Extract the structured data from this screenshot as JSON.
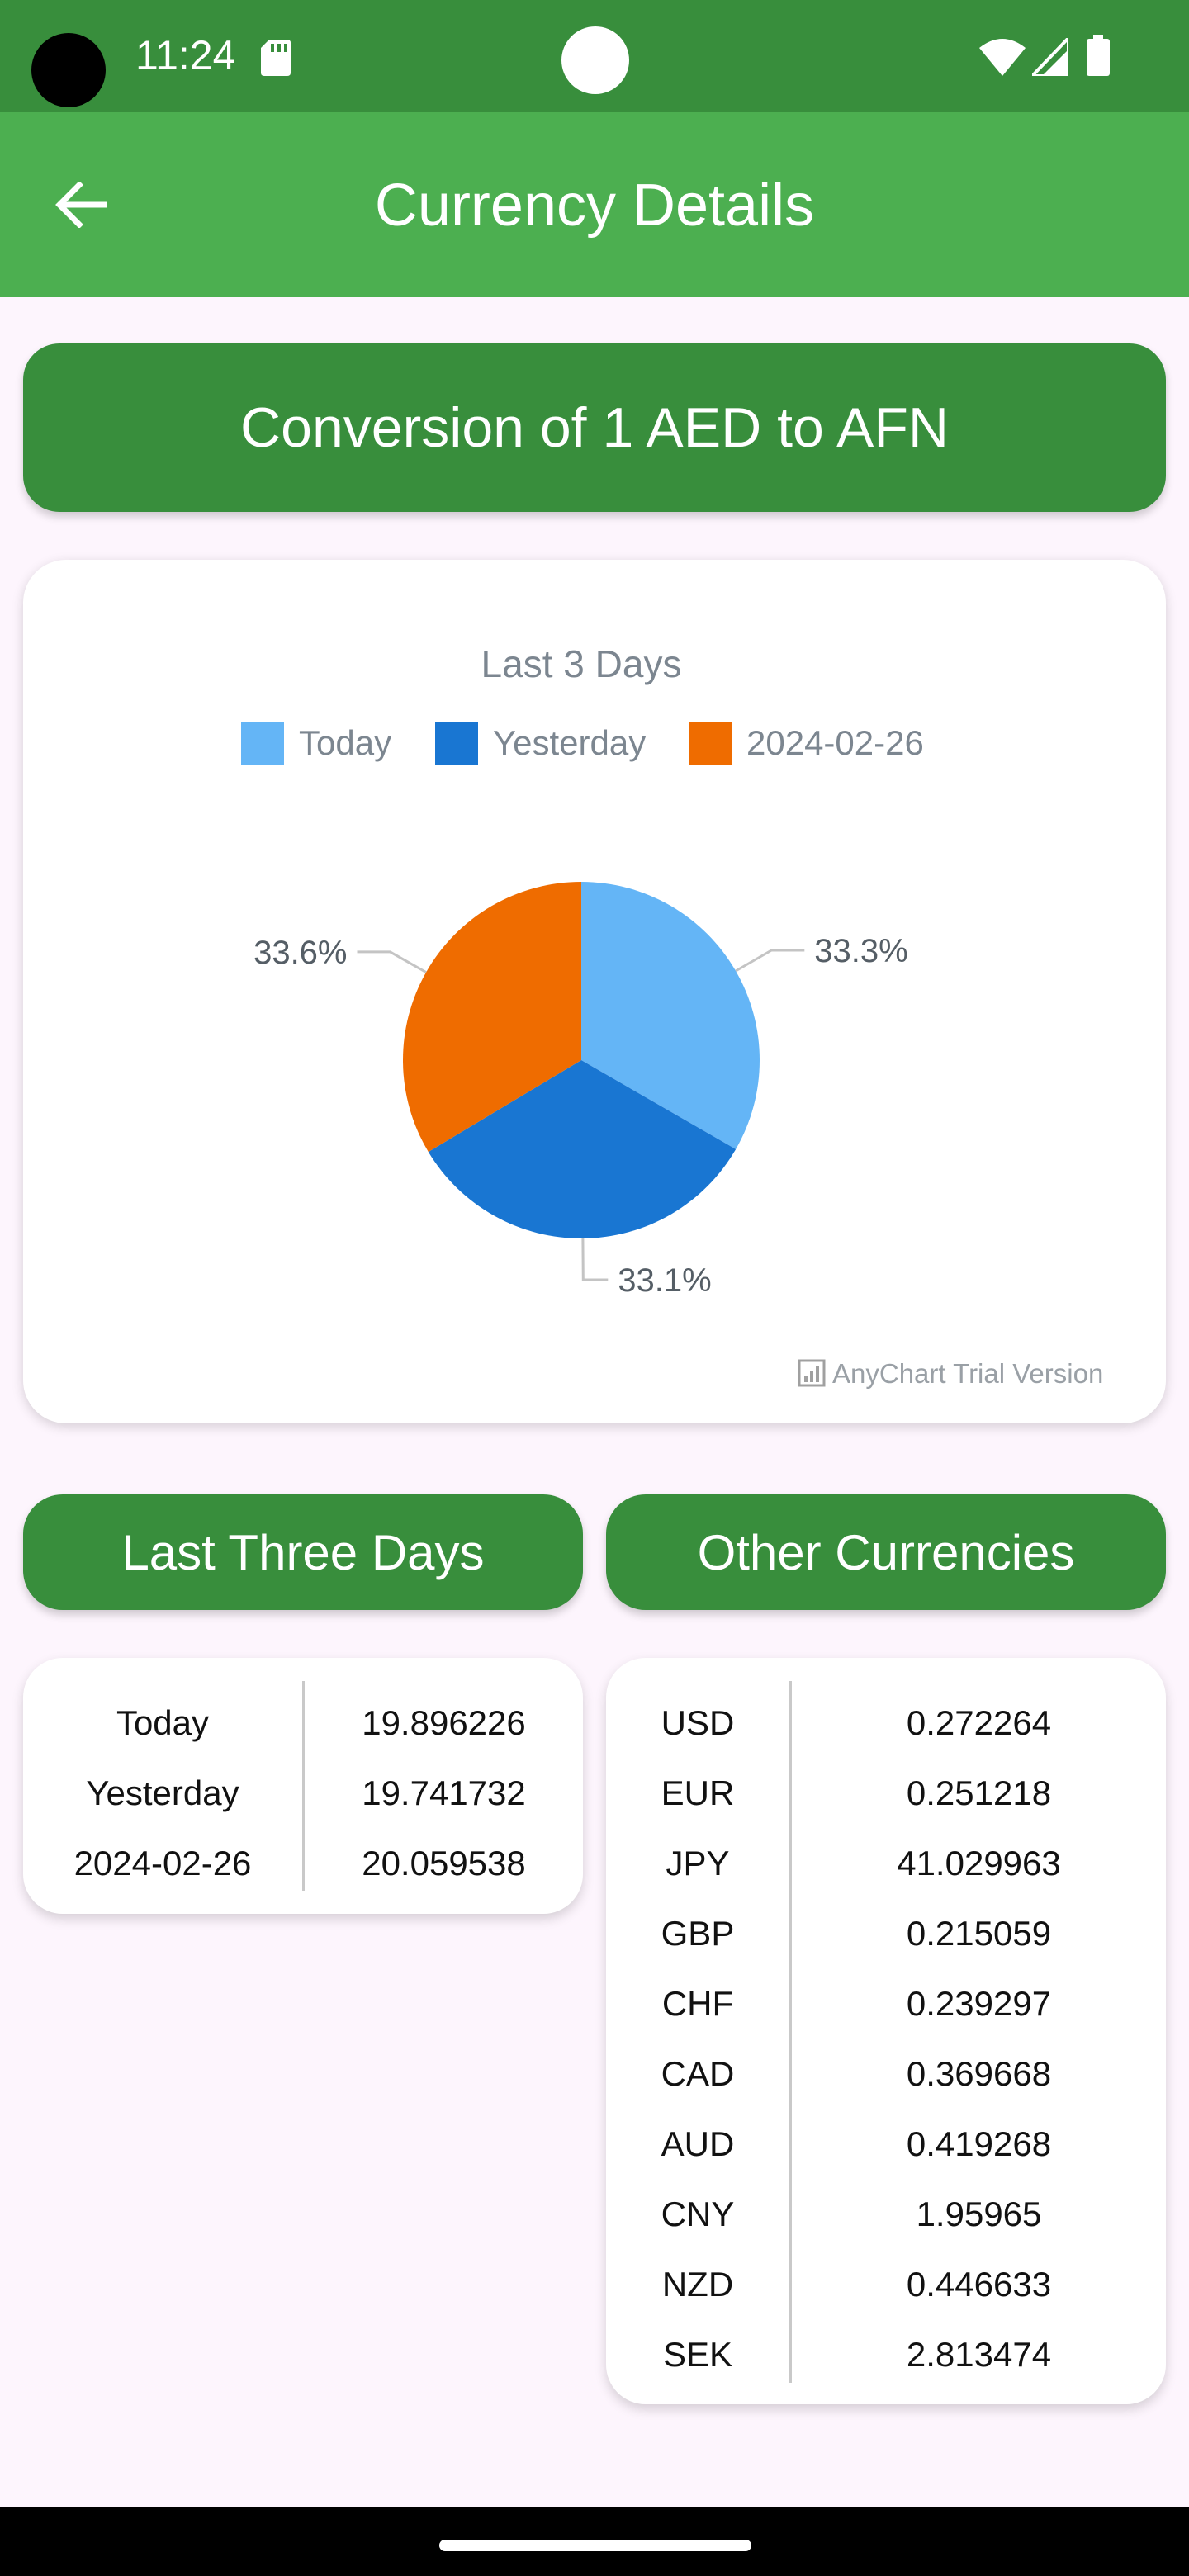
{
  "status_bar": {
    "time": "11:24",
    "icons": [
      "sd-card-icon",
      "wifi-icon",
      "signal-icon",
      "battery-icon"
    ]
  },
  "app_bar": {
    "title": "Currency Details",
    "back_icon": "arrow-left-icon"
  },
  "conversion": {
    "label": "Conversion of 1 AED to AFN"
  },
  "chart_data": {
    "type": "pie",
    "title": "Last 3 Days",
    "legend_position": "top",
    "categories": [
      "Today",
      "Yesterday",
      "2024-02-26"
    ],
    "values": [
      19.896226,
      19.741732,
      20.059538
    ],
    "percent_labels": [
      "33.3%",
      "33.1%",
      "33.6%"
    ],
    "colors": [
      "#64b5f6",
      "#1976d2",
      "#ef6c00"
    ],
    "watermark": "AnyChart Trial Version"
  },
  "buttons": {
    "last_three_days": "Last Three Days",
    "other_currencies": "Other Currencies"
  },
  "last_three_days": [
    {
      "label": "Today",
      "value": "19.896226"
    },
    {
      "label": "Yesterday",
      "value": "19.741732"
    },
    {
      "label": "2024-02-26",
      "value": "20.059538"
    }
  ],
  "other_currencies": [
    {
      "code": "USD",
      "value": "0.272264"
    },
    {
      "code": "EUR",
      "value": "0.251218"
    },
    {
      "code": "JPY",
      "value": "41.029963"
    },
    {
      "code": "GBP",
      "value": "0.215059"
    },
    {
      "code": "CHF",
      "value": "0.239297"
    },
    {
      "code": "CAD",
      "value": "0.369668"
    },
    {
      "code": "AUD",
      "value": "0.419268"
    },
    {
      "code": "CNY",
      "value": "1.95965"
    },
    {
      "code": "NZD",
      "value": "0.446633"
    },
    {
      "code": "SEK",
      "value": "2.813474"
    }
  ],
  "colors": {
    "status_bar": "#388e3c",
    "app_bar": "#4caf50",
    "primary_button": "#388e3c",
    "background": "#fdf5fd"
  }
}
